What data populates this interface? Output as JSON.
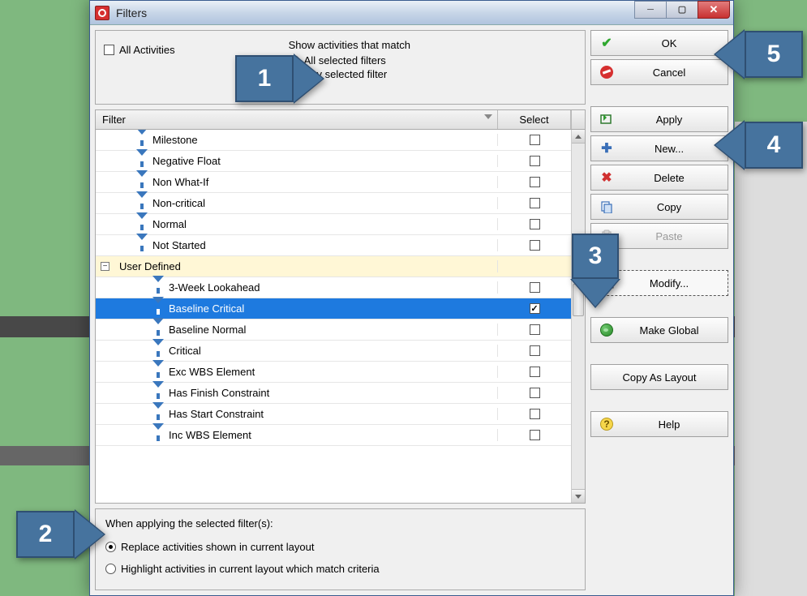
{
  "window": {
    "title": "Filters"
  },
  "top": {
    "all_activities_label": "All Activities",
    "match_title": "Show activities that match",
    "match_all": "All selected filters",
    "match_any": "Any selected filter"
  },
  "headers": {
    "filter": "Filter",
    "select": "Select"
  },
  "group_label": "User Defined",
  "filters_top": [
    {
      "label": "Milestone",
      "checked": false
    },
    {
      "label": "Negative Float",
      "checked": false
    },
    {
      "label": "Non What-If",
      "checked": false
    },
    {
      "label": "Non-critical",
      "checked": false
    },
    {
      "label": "Normal",
      "checked": false
    },
    {
      "label": "Not Started",
      "checked": false
    }
  ],
  "filters_user": [
    {
      "label": "3-Week Lookahead",
      "checked": false,
      "selected": false
    },
    {
      "label": "Baseline Critical",
      "checked": true,
      "selected": true
    },
    {
      "label": "Baseline Normal",
      "checked": false,
      "selected": false
    },
    {
      "label": "Critical",
      "checked": false,
      "selected": false
    },
    {
      "label": "Exc WBS Element",
      "checked": false,
      "selected": false
    },
    {
      "label": "Has Finish Constraint",
      "checked": false,
      "selected": false
    },
    {
      "label": "Has Start Constraint",
      "checked": false,
      "selected": false
    },
    {
      "label": "Inc WBS Element",
      "checked": false,
      "selected": false
    }
  ],
  "bottom": {
    "title": "When applying the selected filter(s):",
    "opt_replace": "Replace activities shown in current layout",
    "opt_highlight": "Highlight activities in current layout which match criteria"
  },
  "buttons": {
    "ok": "OK",
    "cancel": "Cancel",
    "apply": "Apply",
    "new": "New...",
    "delete": "Delete",
    "copy": "Copy",
    "paste": "Paste",
    "modify": "Modify...",
    "make_global": "Make Global",
    "copy_layout": "Copy As Layout",
    "help": "Help"
  },
  "callouts": {
    "c1": "1",
    "c2": "2",
    "c3": "3",
    "c4": "4",
    "c5": "5"
  }
}
